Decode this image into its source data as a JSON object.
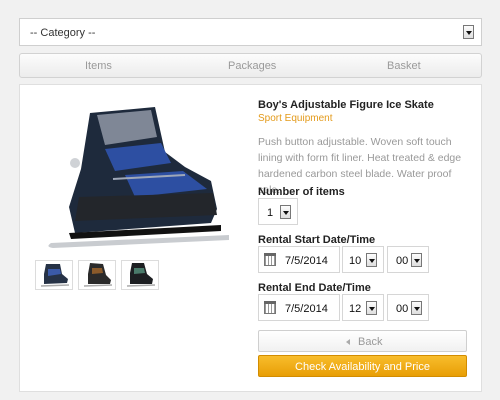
{
  "category": {
    "selected": "-- Category --"
  },
  "tabs": [
    {
      "label": "Items"
    },
    {
      "label": "Packages"
    },
    {
      "label": "Basket"
    }
  ],
  "product": {
    "title": "Boy's Adjustable Figure Ice Skate",
    "category": "Sport Equipment",
    "description": "Push button adjustable. Woven soft touch lining with form fit liner. Heat treated & edge hardened carbon steel blade. Water proof sole."
  },
  "form": {
    "items_label": "Number of items",
    "items_value": "1",
    "start_label": "Rental Start Date/Time",
    "start_date": "7/5/2014",
    "start_hour": "10",
    "start_min": "00",
    "end_label": "Rental End Date/Time",
    "end_date": "7/5/2014",
    "end_hour": "12",
    "end_min": "00"
  },
  "buttons": {
    "back": "Back",
    "check": "Check Availability and Price"
  },
  "colors": {
    "accent": "#f0a818",
    "subtitle": "#e39a1a"
  }
}
